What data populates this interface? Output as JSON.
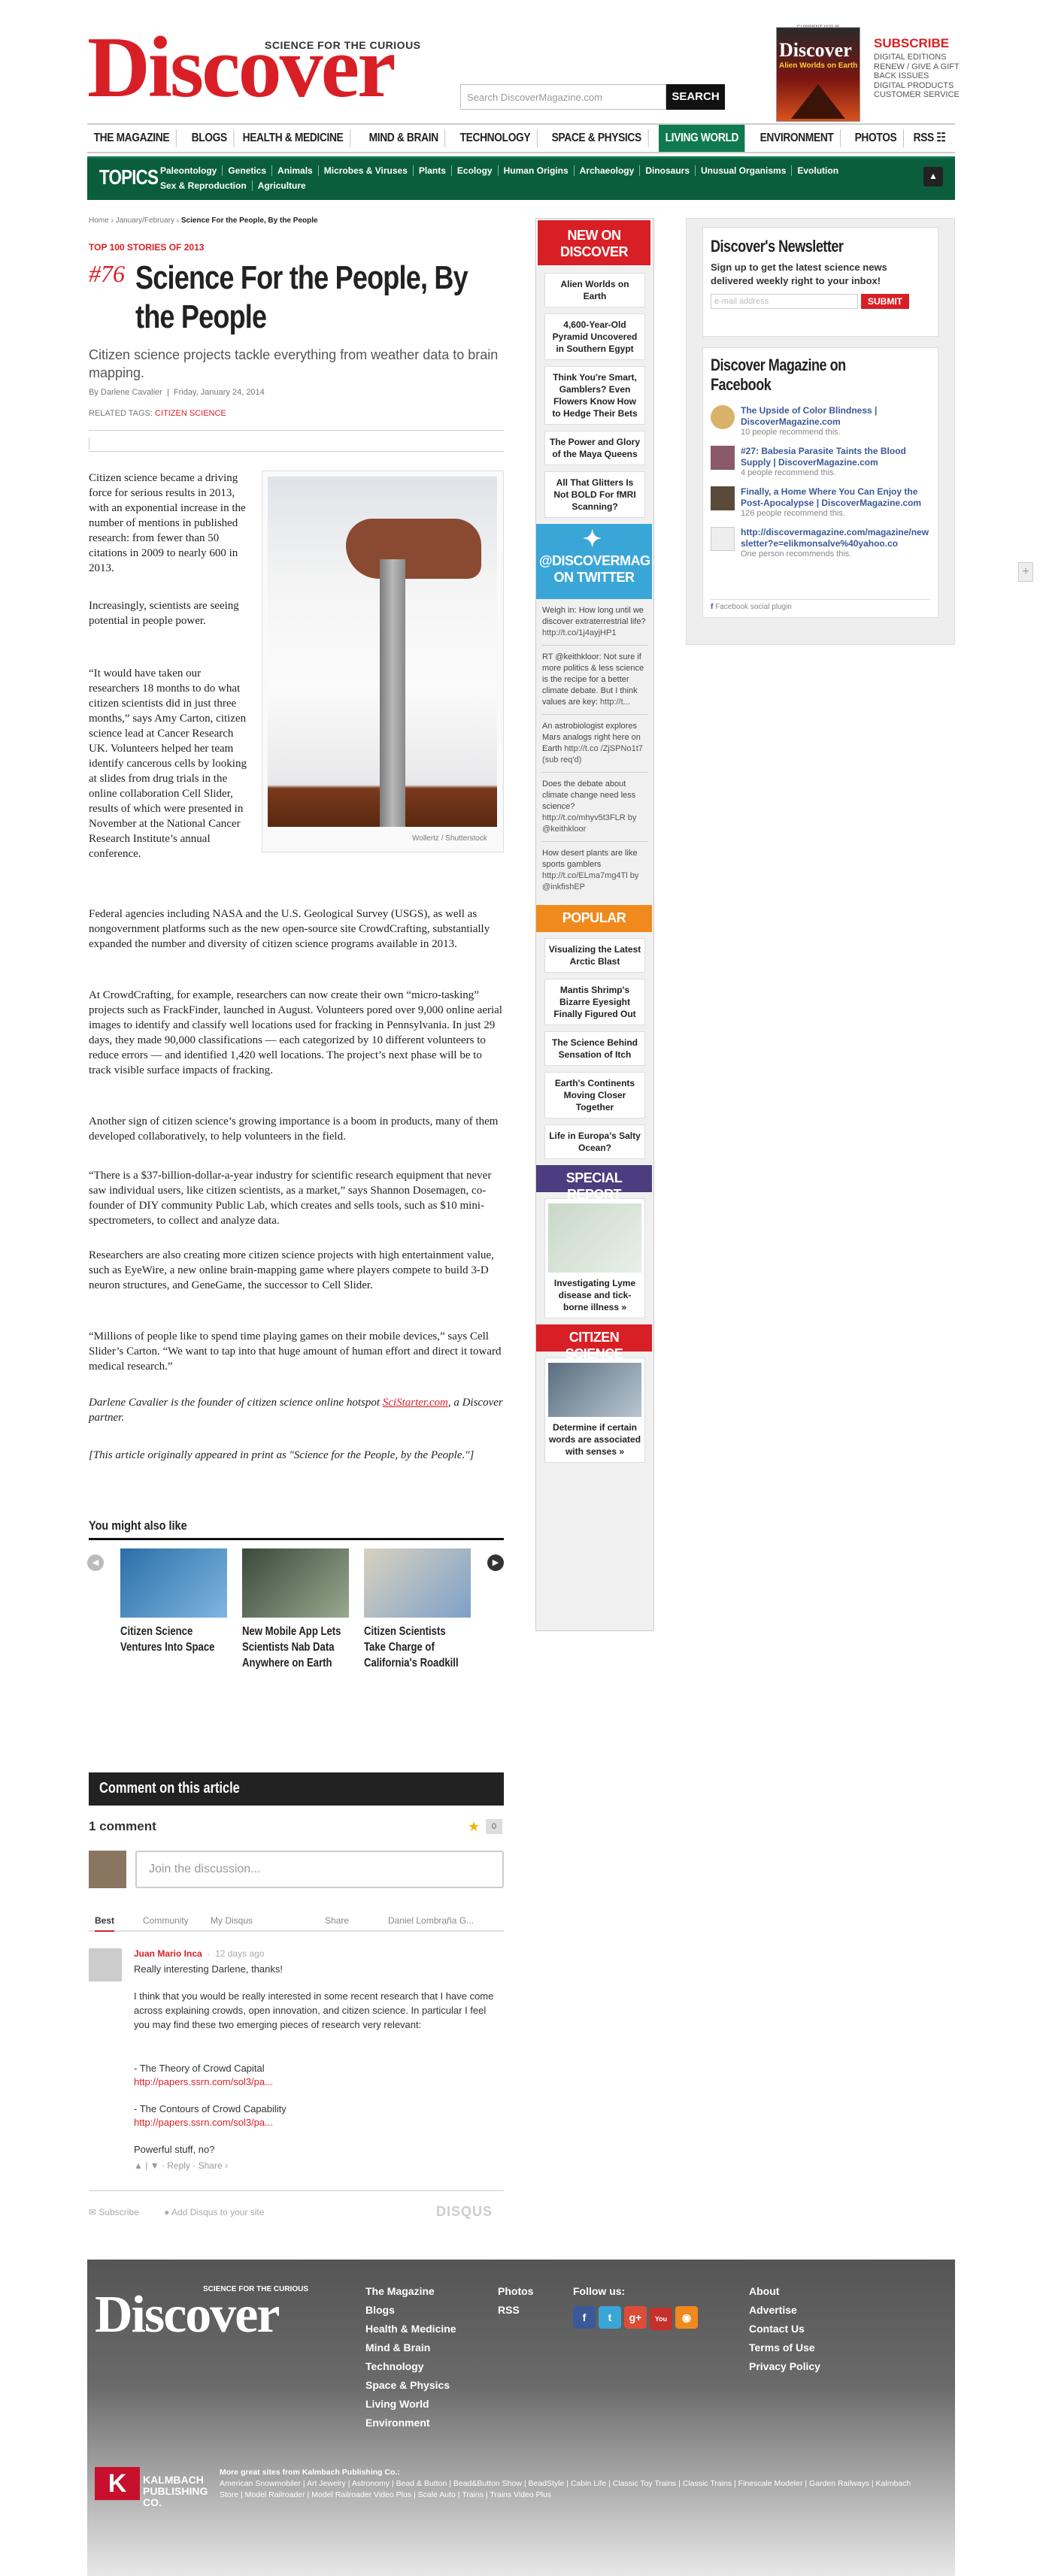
{
  "header": {
    "tagline": "SCIENCE FOR THE CURIOUS",
    "logo": "Discover",
    "search_placeholder": "Search DiscoverMagazine.com",
    "search_button": "SEARCH",
    "current_issue_label": "CURRENT ISSUE",
    "cover_title": "Discover",
    "cover_headline": "Alien Worlds on Earth",
    "subscribe": "SUBSCRIBE",
    "subscribe_links": [
      "DIGITAL EDITIONS",
      "RENEW / GIVE A GIFT",
      "BACK ISSUES",
      "DIGITAL PRODUCTS",
      "CUSTOMER SERVICE"
    ]
  },
  "nav": {
    "items": [
      "THE MAGAZINE",
      "BLOGS",
      "HEALTH & MEDICINE",
      "MIND & BRAIN",
      "TECHNOLOGY",
      "SPACE & PHYSICS",
      "LIVING WORLD",
      "ENVIRONMENT",
      "PHOTOS",
      "RSS"
    ],
    "active": "LIVING WORLD"
  },
  "topics": {
    "label": "TOPICS",
    "row1": [
      "Paleontology",
      "Genetics",
      "Animals",
      "Microbes & Viruses",
      "Plants",
      "Ecology",
      "Human Origins",
      "Archaeology",
      "Dinosaurs",
      "Unusual Organisms",
      "Evolution"
    ],
    "row2": [
      "Sex & Reproduction",
      "Agriculture"
    ]
  },
  "article": {
    "breadcrumb": [
      "Home",
      "January/February",
      "Science For the People, By the People"
    ],
    "kicker": "TOP 100 STORIES OF 2013",
    "rank": "#76",
    "title": "Science For the People, By the People",
    "dek": "Citizen science projects tackle everything from weather data to brain mapping.",
    "author": "By Darlene Cavalier",
    "date": "Friday, January 24, 2014",
    "tags_label": "RELATED TAGS:",
    "tag": "CITIZEN SCIENCE",
    "photo_credit": "Wollertz / Shutterstock",
    "p1": "Citizen science became a driving force for serious results in 2013, with an exponential increase in the number of mentions in published research: from fewer than 50 citations in 2009 to nearly 600 in 2013.",
    "p2": "Increasingly, scientists are seeing potential in people power.",
    "p3": "“It would have taken our researchers 18 months to do what citizen scientists did in just three months,” says Amy Carton, citizen science lead at Cancer Research UK. Volunteers helped her team identify cancerous cells by looking at slides from drug trials in the online collaboration Cell Slider, results of which were presented in November at the National Cancer Research Institute’s annual conference.",
    "p4": "Federal agencies including NASA and the U.S. Geological Survey (USGS), as well as nongovernment platforms such as the new open-source site CrowdCrafting, substantially expanded the number and diversity of citizen science programs available in 2013.",
    "p5": "At CrowdCrafting, for example, researchers can now create their own “micro-tasking” projects such as FrackFinder, launched in August. Volunteers pored over 9,000 online aerial images to identify and classify well locations used for fracking in Pennsylvania. In just 29 days, they made 90,000 classifications — each categorized by 10 different volunteers to reduce errors — and identified 1,420 well locations. The project’s next phase will be to track visible surface impacts of fracking.",
    "p6": "Another sign of citizen science’s growing importance is a boom in products, many of them developed collaboratively, to help volunteers in the field.",
    "p7": "“There is a $37-billion-dollar-a-year industry for scientific research equipment that never saw individual users, like citizen scientists, as a market,” says Shannon Dosemagen, co-founder of DIY community Public Lab, which creates and sells tools, such as $10 mini-spectrometers, to collect and analyze data.",
    "p8": "Researchers are also creating more citizen science projects with high entertainment value, such as EyeWire, a new online brain-mapping game where players compete to build 3-D neuron structures, and GeneGame, the successor to Cell Slider.",
    "p9": "“Millions of people like to spend time playing games on their mobile devices,” says Cell Slider’s Carton. “We want to tap into that huge amount of human effort and direct it toward medical research.”",
    "p10_a": "Darlene Cavalier is the founder of citizen science online hotspot ",
    "p10_link": "SciStarter.com",
    "p10_b": ", a Discover partner.",
    "p11": "[This article originally appeared in print as \"Science for the People, by the People.\"]"
  },
  "related": {
    "title": "You might also like",
    "items": [
      {
        "caption": "Citizen Science Ventures Into Space"
      },
      {
        "caption": "New Mobile App Lets Scientists Nab Data Anywhere on Earth"
      },
      {
        "caption": "Citizen Scientists Take Charge of California's Roadkill"
      }
    ]
  },
  "comments": {
    "bar": "Comment on this article",
    "count": "1 comment",
    "star_count": "0",
    "join_placeholder": "Join the discussion...",
    "tabs": [
      "Best",
      "Community",
      "My Disqus"
    ],
    "share": "Share",
    "user": "Daniel Lombraña G...",
    "comment_author": "Juan Mario Inca",
    "comment_age": "12 days ago",
    "c1": "Really interesting Darlene, thanks!",
    "c2": "I think that you would be really interested in some recent research that I have come across explaining crowds, open innovation, and citizen science. In particular I feel you may find these two emerging pieces of research very relevant:",
    "c3": "- The Theory of Crowd Capital",
    "c3_link": "http://papers.ssrn.com/sol3/pa...",
    "c4": "- The Contours of Crowd Capability",
    "c4_link": "http://papers.ssrn.com/sol3/pa...",
    "c5": "Powerful stuff, no?",
    "actions": "Reply · Share ›",
    "subscribe": "Subscribe",
    "add_disqus": "Add Disqus to your site",
    "disqus": "DISQUS"
  },
  "rail": {
    "new_head": "NEW ON DISCOVER",
    "new_items": [
      "Alien Worlds on Earth",
      "4,600-Year-Old Pyramid Uncovered in Southern Egypt",
      "Think You're Smart, Gamblers? Even Flowers Know How to Hedge Their Bets",
      "The Power and Glory of the Maya Queens",
      "All That Glitters Is Not BOLD For fMRI Scanning?"
    ],
    "twitter_head": "@DISCOVERMAG ON TWITTER",
    "tweets": [
      {
        "text": "Weigh in: How long until we discover extraterrestrial life?",
        "link": "http://t.co/1j4ayjHP1"
      },
      {
        "text": "RT @keithkloor: Not sure if more politics & less science is the recipe for a better climate debate. But I think values are key:",
        "link": "http://t..."
      },
      {
        "text": "An astrobiologist explores Mars analogs right here on Earth",
        "link": "http://t.co /ZjSPNo1t7 (sub req'd)"
      },
      {
        "text": "Does the debate about climate change need less science?",
        "link": "http://t.co/mhyv5t3FLR by @keithkloor"
      },
      {
        "text": "How desert plants are like sports gamblers",
        "link": "http://t.co/ELma7mg4Tl by @inkfishEP"
      }
    ],
    "popular_head": "POPULAR",
    "popular_items": [
      "Visualizing the Latest Arctic Blast",
      "Mantis Shrimp's Bizarre Eyesight Finally Figured Out",
      "The Science Behind Sensation of Itch",
      "Earth's Continents Moving Closer Together",
      "Life in Europa's Salty Ocean?"
    ],
    "special_head": "SPECIAL REPORT",
    "special_caption": "Investigating Lyme disease and tick-borne illness »",
    "citizen_head": "CITIZEN SCIENCE",
    "citizen_caption": "Determine if certain words are associated with senses »"
  },
  "newsletter": {
    "title": "Discover's Newsletter",
    "text": "Sign up to get the latest science news delivered weekly right to your inbox!",
    "placeholder": "e-mail address",
    "button": "SUBMIT"
  },
  "facebook": {
    "title": "Discover Magazine on Facebook",
    "items": [
      {
        "link": "The Upside of Color Blindness | DiscoverMagazine.com",
        "sub": "10 people recommend this."
      },
      {
        "link": "#27: Babesia Parasite Taints the Blood Supply | DiscoverMagazine.com",
        "sub": "4 people recommend this."
      },
      {
        "link": "Finally, a Home Where You Can Enjoy the Post-Apocalypse | DiscoverMagazine.com",
        "sub": "126 people recommend this."
      },
      {
        "link": "http://discovermagazine.com/magazine/newsletter?e=elikmonsalve%40yahoo.co",
        "sub": "One person recommends this."
      }
    ],
    "plugin": "Facebook social plugin"
  },
  "footer": {
    "logo": "Discover",
    "tagline": "SCIENCE FOR THE CURIOUS",
    "col1": [
      "The Magazine",
      "Blogs",
      "Health & Medicine",
      "Mind & Brain",
      "Technology",
      "Space & Physics",
      "Living World",
      "Environment"
    ],
    "col2": [
      "Photos",
      "RSS"
    ],
    "follow": "Follow us:",
    "col4": [
      "About",
      "Advertise",
      "Contact Us",
      "Terms of Use",
      "Privacy Policy"
    ],
    "kalmbach": "KALMBACH PUBLISHING CO.",
    "more_label": "More great sites from Kalmbach Publishing Co.:",
    "more_sites": "American Snowmobiler | Art Jewelry | Astronomy | Bead & Button | Bead&Button Show | BeadStyle | Cabin Life | Classic Toy Trains | Classic Trains | Finescale Modeler | Garden Railways | Kalmbach Store | Model Railroader | Model Railroader Video Plus | Scale Auto | Trains | Trains Video Plus"
  },
  "colors": {
    "brand_red": "#d91f26",
    "nav_green": "#0f7a4f",
    "twitter_blue": "#3aa6d8",
    "popular_orange": "#f08a1c",
    "special_purple": "#4b3d7f"
  }
}
